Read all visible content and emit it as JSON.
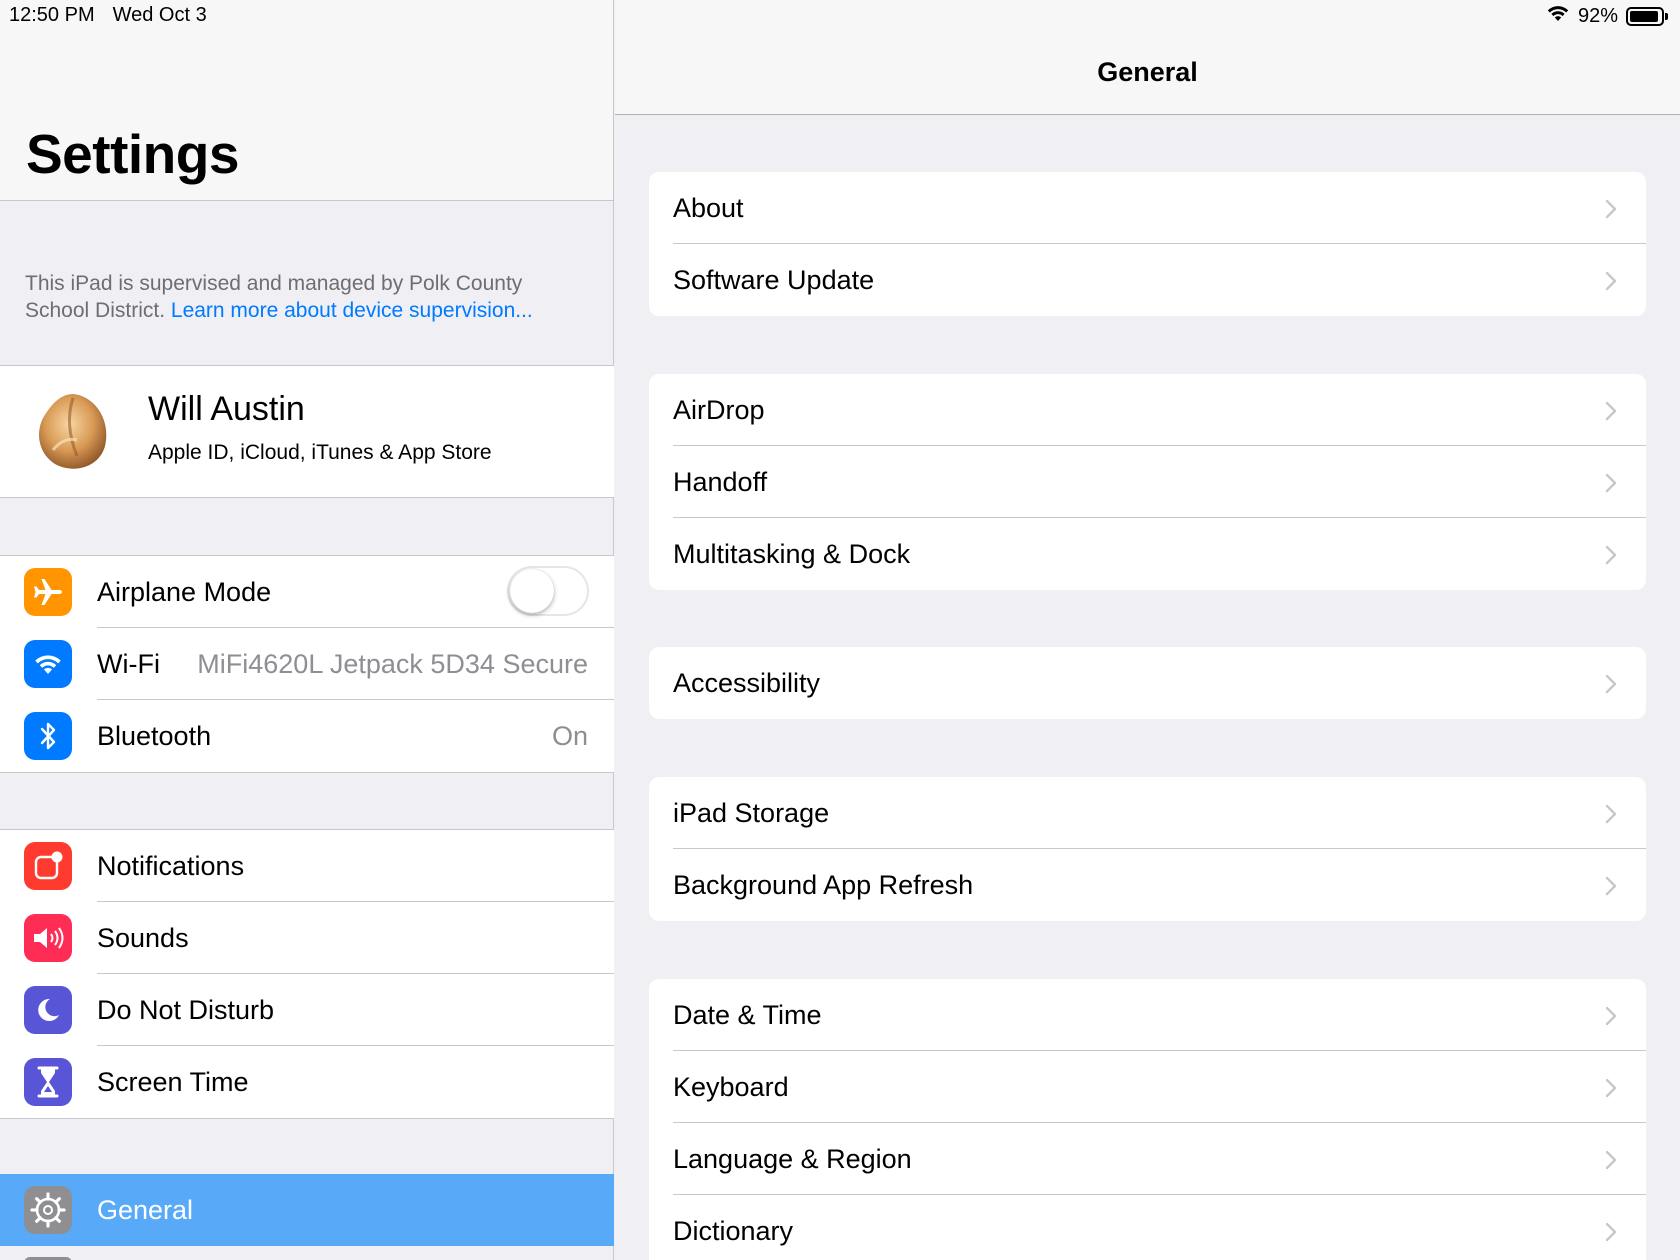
{
  "status_bar": {
    "time": "12:50 PM",
    "date": "Wed Oct 3",
    "battery": "92%",
    "battery_level": 0.92
  },
  "master": {
    "title": "Settings",
    "supervision_text": "This iPad is supervised and managed by Polk County School District.",
    "supervision_link": "Learn more about device supervision...",
    "profile": {
      "name": "Will Austin",
      "subtitle": "Apple ID, iCloud, iTunes & App Store"
    },
    "connectivity": [
      {
        "label": "Airplane Mode",
        "icon": "airplane-icon",
        "color": "#ff9500",
        "toggle": false
      },
      {
        "label": "Wi-Fi",
        "icon": "wifi-icon",
        "color": "#007aff",
        "value": "MiFi4620L Jetpack 5D34 Secure"
      },
      {
        "label": "Bluetooth",
        "icon": "bluetooth-icon",
        "color": "#007aff",
        "value": "On"
      }
    ],
    "notifications": [
      {
        "label": "Notifications",
        "icon": "notifications-icon",
        "color": "#ff3b30"
      },
      {
        "label": "Sounds",
        "icon": "speaker-icon",
        "color": "#ff2d55"
      },
      {
        "label": "Do Not Disturb",
        "icon": "moon-icon",
        "color": "#5856d6"
      },
      {
        "label": "Screen Time",
        "icon": "hourglass-icon",
        "color": "#5856d6"
      }
    ],
    "selected": {
      "label": "General",
      "icon": "gear-icon",
      "color": "#8e8e93"
    }
  },
  "detail": {
    "title": "General",
    "groups": [
      [
        "About",
        "Software Update"
      ],
      [
        "AirDrop",
        "Handoff",
        "Multitasking & Dock"
      ],
      [
        "Accessibility"
      ],
      [
        "iPad Storage",
        "Background App Refresh"
      ],
      [
        "Date & Time",
        "Keyboard",
        "Language & Region",
        "Dictionary"
      ]
    ]
  }
}
